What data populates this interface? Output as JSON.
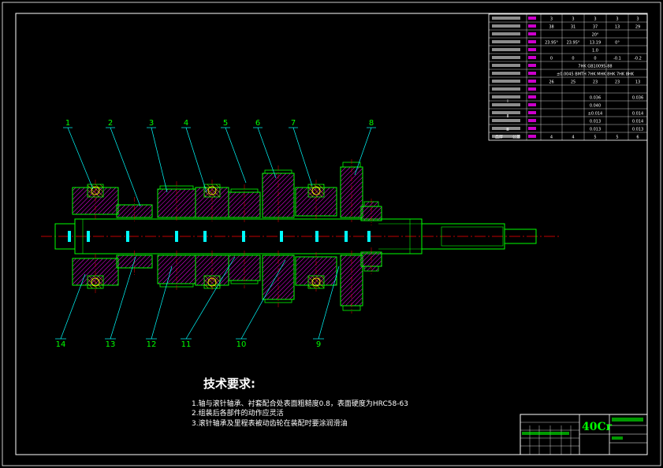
{
  "material": "40Cr",
  "tech_requirements": {
    "title": "技术要求:",
    "items": [
      "1.轴与滚针轴承、衬套配合处表面粗糙度0.8，表面硬度为HRC58-63",
      "2.组装后各部件的动作应灵活",
      "3.滚针轴承及里程表被动齿轮在装配时要涂润滑油"
    ]
  },
  "balloons": {
    "top": [
      "1",
      "2",
      "3",
      "4",
      "5",
      "6",
      "7",
      "8"
    ],
    "bottom": [
      "14",
      "13",
      "12",
      "11",
      "10",
      "9"
    ]
  },
  "gear_table": {
    "row_values": [
      [
        "3",
        "3",
        "3",
        "3",
        "3"
      ],
      [
        "38",
        "31",
        "37",
        "13",
        "29"
      ],
      [
        "",
        "",
        "20°",
        "",
        ""
      ],
      [
        "23.95°",
        "23.95°",
        "13.19",
        "0°",
        ""
      ],
      [
        "",
        "",
        "1.0",
        "",
        ""
      ],
      [
        "0",
        "0",
        "0",
        "-0.1",
        "-0.2"
      ],
      [
        "",
        "",
        "7HK GB10095-88",
        "",
        ""
      ],
      [
        "",
        "",
        "±0.0045 BMTH 7HK MHK 8HK 7HK 8HK",
        "",
        ""
      ],
      [
        "26",
        "25",
        "23",
        "23",
        "13"
      ],
      [
        "",
        "",
        "",
        "",
        ""
      ],
      [
        "",
        "",
        "0.036",
        "",
        "0.036"
      ],
      [
        "",
        "",
        "0.040",
        "",
        ""
      ],
      [
        "",
        "",
        "±0.014",
        "",
        "0.014"
      ],
      [
        "",
        "",
        "0.013",
        "",
        "0.014"
      ],
      [
        "",
        "",
        "0.013",
        "",
        "0.013"
      ],
      [
        "4",
        "4",
        "5",
        "5",
        "6"
      ]
    ],
    "left_labels": [
      "Ⅰ",
      "Ⅱ",
      "Ⅲ"
    ],
    "bottom_labels": [
      "齿厚",
      "公差"
    ]
  },
  "colors": {
    "background": "#000000",
    "frame": "#ffffff",
    "part": "#00ff00",
    "hatch": "#ff00ff",
    "centerline": "#ff0000",
    "leader": "#00ffff",
    "label": "#00ff00",
    "text": "#ffffff"
  }
}
